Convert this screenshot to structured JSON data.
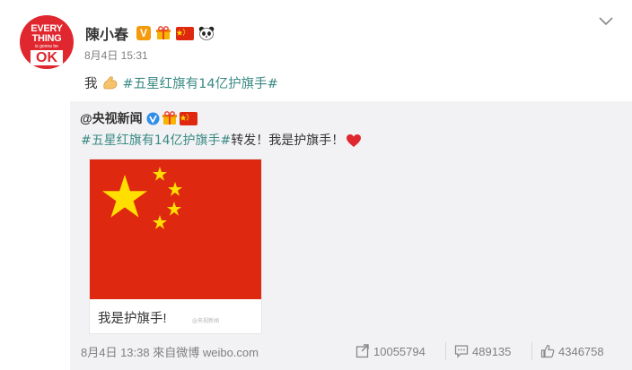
{
  "post": {
    "author": "陳小春",
    "avatar_lines": [
      "EVERY",
      "THING",
      "is gonna be",
      "OK"
    ],
    "time": "8月4日 15:31",
    "text_prefix": "我",
    "hashtag": "#五星红旗有14亿护旗手#"
  },
  "repost": {
    "author": "@央视新闻",
    "hashtag": "#五星红旗有14亿护旗手#",
    "text": "转发！我是护旗手！",
    "image_caption": "我是护旗手!",
    "image_watermark": "@央视新闻",
    "footer": "8月4日 13:38 來自微博 weibo.com",
    "stats": {
      "forwards": "10055794",
      "comments": "489135",
      "likes": "4346758"
    }
  },
  "colors": {
    "flag_red": "#de2910",
    "flag_star": "#ffde00",
    "hashtag": "#eb7350",
    "repost_bg": "#f2f2f5"
  },
  "icons": [
    "verified-icon",
    "gift-icon",
    "china-flag-icon",
    "panda-icon",
    "chevron-down-icon",
    "flexed-biceps-icon",
    "heart-icon",
    "forward-icon",
    "comment-icon",
    "like-icon"
  ]
}
